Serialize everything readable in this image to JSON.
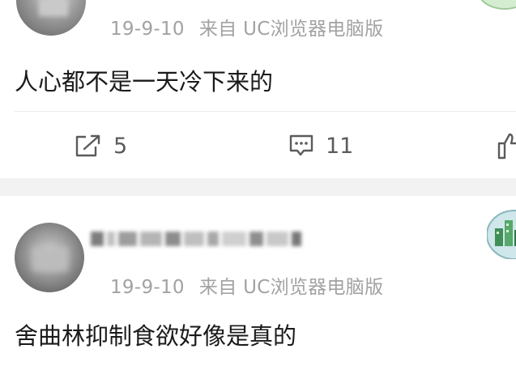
{
  "post1": {
    "date": "19-9-10",
    "source": "来自 UC浏览器电脑版",
    "text": "人心都不是一天冷下来的",
    "actions": {
      "repost_count": "5",
      "comment_count": "11"
    }
  },
  "post2": {
    "date": "19-9-10",
    "source": "来自 UC浏览器电脑版",
    "text": "舍曲林抑制食欲好像是真的"
  },
  "icons": [
    "repost-icon",
    "comment-icon",
    "like-icon"
  ],
  "colors": {
    "meta_text": "#a2a2a2",
    "body_text": "#1a1a1a",
    "action_text": "#5b5b5b",
    "separator": "#f2f2f2"
  }
}
